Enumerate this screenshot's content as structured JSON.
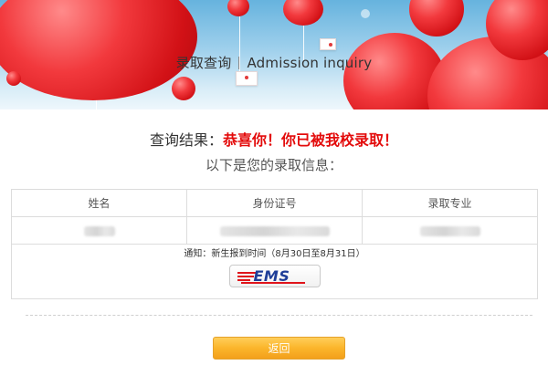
{
  "header": {
    "title_cn": "录取查询",
    "title_en": "Admission inquiry"
  },
  "result": {
    "label": "查询结果：",
    "message": "恭喜你！你已被我校录取！",
    "subtitle": "以下是您的录取信息："
  },
  "table": {
    "headers": [
      "姓名",
      "身份证号",
      "录取专业"
    ],
    "notice": "通知：新生报到时间（8月30日至8月31日）"
  },
  "ems": {
    "logo_text": "EMS"
  },
  "footer": {
    "back_label": "返回"
  },
  "colors": {
    "accent_red": "#e30b0b",
    "button_orange": "#fbb52b",
    "ems_blue": "#1f3e98"
  }
}
